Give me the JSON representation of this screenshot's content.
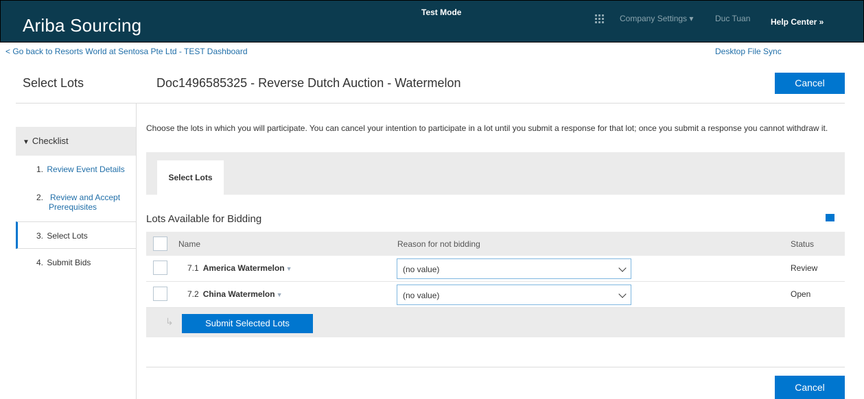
{
  "header": {
    "brand": "Ariba Sourcing",
    "test_mode": "Test Mode",
    "company_settings": "Company Settings ▾",
    "user": "Duc Tuan",
    "help_center": "Help Center »"
  },
  "links": {
    "back": "< Go back to Resorts World at Sentosa Pte Ltd - TEST Dashboard",
    "desktop_sync": "Desktop File Sync"
  },
  "page": {
    "left_title": "Select Lots",
    "doc_title": "Doc1496585325 - Reverse Dutch Auction - Watermelon",
    "cancel_label": "Cancel"
  },
  "sidebar": {
    "checklist_label": "Checklist",
    "steps": [
      {
        "num": "1.",
        "label": "Review Event Details"
      },
      {
        "num": "2.",
        "label": "Review and Accept Prerequisites"
      },
      {
        "num": "3.",
        "label": "Select Lots"
      },
      {
        "num": "4.",
        "label": "Submit Bids"
      }
    ]
  },
  "main": {
    "intro": "Choose the lots in which you will participate.  You can cancel your intention to participate in a lot until you submit a response for that lot;  once you submit a response you cannot withdraw it.",
    "tab_label": "Select Lots",
    "section_title": "Lots Available for Bidding",
    "columns": {
      "name": "Name",
      "reason": "Reason for not bidding",
      "status": "Status"
    },
    "rows": [
      {
        "num": "7.1",
        "name": "America Watermelon",
        "reason": "(no value)",
        "status": "Review"
      },
      {
        "num": "7.2",
        "name": "China Watermelon",
        "reason": "(no value)",
        "status": "Open"
      }
    ],
    "submit_label": "Submit Selected Lots"
  },
  "colors": {
    "header_bg": "#0c3b4f",
    "accent": "#0076cf",
    "link": "#1f6ea8"
  },
  "icons": [
    "apps-grid-icon",
    "caret-down-icon",
    "table-options-icon",
    "chevron-down-icon",
    "return-arrow-icon"
  ]
}
